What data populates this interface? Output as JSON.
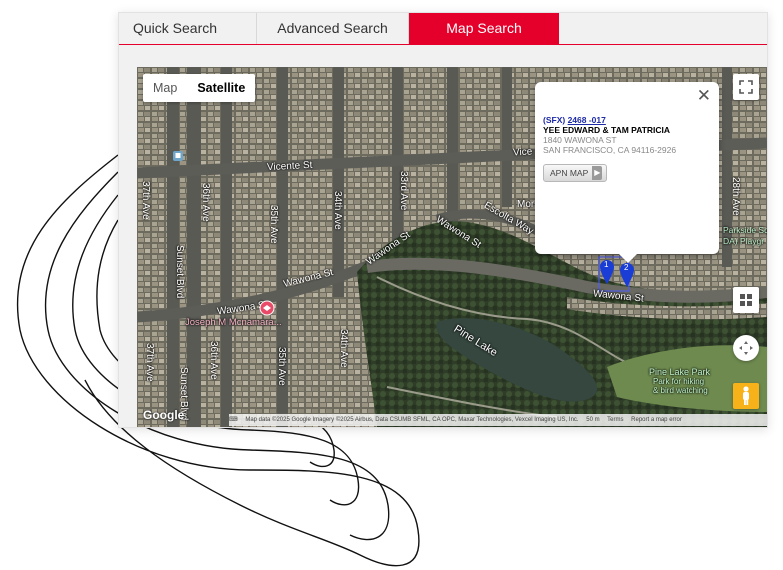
{
  "tabs": [
    {
      "label": "Quick Search"
    },
    {
      "label": "Advanced Search"
    },
    {
      "label": "Map Search"
    }
  ],
  "map": {
    "type_buttons": {
      "map": "Map",
      "satellite": "Satellite",
      "selected": "Satellite"
    },
    "info_window": {
      "prefix": "(SFX)",
      "apn": "2468 -017",
      "owner": "YEE EDWARD & TAM PATRICIA",
      "address_line1": "1840 WAWONA ST",
      "address_line2": "SAN FRANCISCO, CA 94116-2926",
      "button_label": "APN MAP"
    },
    "markers": [
      "1",
      "2"
    ],
    "labels": {
      "vicente": "Vicente St",
      "vicente2": "Vice",
      "wawona_west": "Wawona St",
      "wawona_mid": "Wawona St",
      "wawona_south": "Wawona St",
      "wawona_diag": "Wawona St",
      "wawona_diag2": "Wawona St",
      "escolta": "Escolta Way",
      "ave33": "33rd Ave",
      "ave34a": "34th Ave",
      "ave34b": "34th Ave",
      "ave35a": "35th Ave",
      "ave35b": "35th Ave",
      "ave36a": "36th Ave",
      "ave36b": "36th Ave",
      "ave37a": "37th Ave",
      "ave37b": "37th Ave",
      "sunset_a": "Sunset Blvd",
      "sunset_b": "Sunset Blvd",
      "ave28": "28th Ave",
      "mor": "Mor",
      "school": "Joseph M Mcnamara...",
      "pine_lake": "Pine Lake",
      "park_name": "Pine Lake Park",
      "park_desc1": "Park for hiking",
      "park_desc2": "& bird watching",
      "parkside1": "Parkside Sq",
      "parkside2": "DA) Playgr"
    },
    "google_logo": "Google",
    "attribution": {
      "data": "Map data ©2025 Google Imagery ©2025 Airbus, Data CSUMB SFML, CA OPC, Maxar Technologies, Vexcel Imaging US, Inc.",
      "scale": "50 m",
      "terms": "Terms",
      "report": "Report a map error"
    }
  }
}
